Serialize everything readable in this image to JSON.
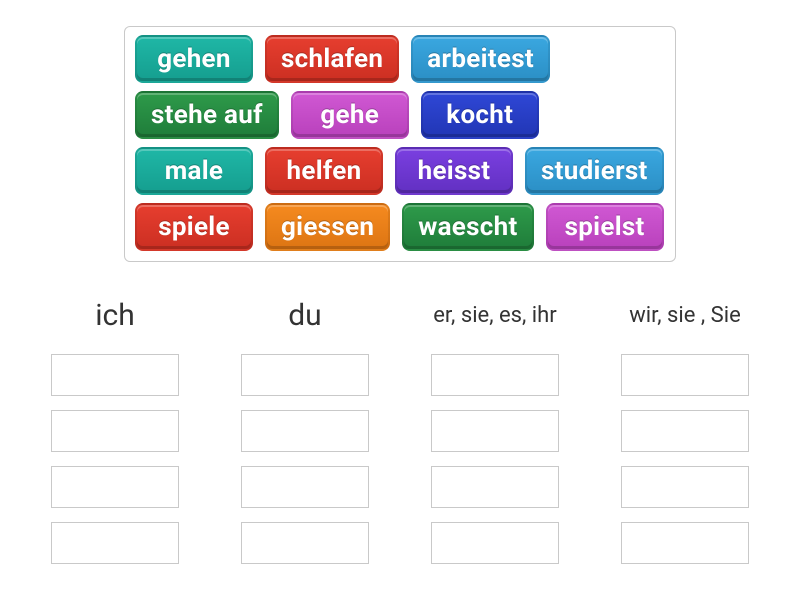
{
  "tiles": [
    {
      "label": "gehen",
      "color": "c-teal"
    },
    {
      "label": "schlafen",
      "color": "c-red"
    },
    {
      "label": "arbeitest",
      "color": "c-cyan"
    },
    {
      "label": "stehe auf",
      "color": "c-green"
    },
    {
      "label": "gehe",
      "color": "c-pink"
    },
    {
      "label": "kocht",
      "color": "c-blue"
    },
    {
      "label": "male",
      "color": "c-teal"
    },
    {
      "label": "helfen",
      "color": "c-red"
    },
    {
      "label": "heisst",
      "color": "c-violet"
    },
    {
      "label": "studierst",
      "color": "c-cyan"
    },
    {
      "label": "spiele",
      "color": "c-red"
    },
    {
      "label": "giessen",
      "color": "c-orange"
    },
    {
      "label": "waescht",
      "color": "c-green"
    },
    {
      "label": "spielst",
      "color": "c-pink"
    }
  ],
  "columns": [
    {
      "title": "ich",
      "small": false,
      "slots": 4
    },
    {
      "title": "du",
      "small": false,
      "slots": 4
    },
    {
      "title": "er, sie, es, ihr",
      "small": true,
      "slots": 4
    },
    {
      "title": "wir, sie , Sie",
      "small": true,
      "slots": 4
    }
  ]
}
